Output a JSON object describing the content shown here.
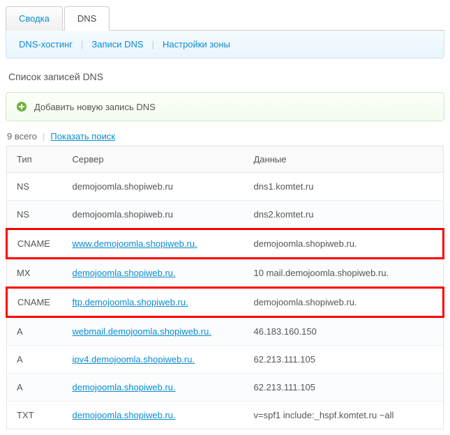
{
  "tabs": {
    "summary": "Сводка",
    "dns": "DNS"
  },
  "subnav": {
    "hosting": "DNS-хостинг",
    "records": "Записи DNS",
    "zone_settings": "Настройки зоны"
  },
  "heading": "Список записей DNS",
  "add_button": "Добавить новую запись DNS",
  "total_count": "9 всего",
  "show_search": "Показать поиск",
  "columns": {
    "type": "Тип",
    "server": "Сервер",
    "data": "Данные"
  },
  "rows": [
    {
      "type": "NS",
      "server": "demojoomla.shopiweb.ru",
      "server_link": false,
      "data": "dns1.komtet.ru",
      "highlight": false
    },
    {
      "type": "NS",
      "server": "demojoomla.shopiweb.ru",
      "server_link": false,
      "data": "dns2.komtet.ru",
      "highlight": false
    },
    {
      "type": "CNAME",
      "server": "www.demojoomla.shopiweb.ru.",
      "server_link": true,
      "data": "demojoomla.shopiweb.ru.",
      "highlight": true
    },
    {
      "type": "MX",
      "server": "demojoomla.shopiweb.ru.",
      "server_link": true,
      "data": "10 mail.demojoomla.shopiweb.ru.",
      "highlight": false
    },
    {
      "type": "CNAME",
      "server": "ftp.demojoomla.shopiweb.ru.",
      "server_link": true,
      "data": "demojoomla.shopiweb.ru.",
      "highlight": true
    },
    {
      "type": "A",
      "server": "webmail.demojoomla.shopiweb.ru.",
      "server_link": true,
      "data": "46.183.160.150",
      "highlight": false
    },
    {
      "type": "A",
      "server": "ipv4.demojoomla.shopiweb.ru.",
      "server_link": true,
      "data": "62.213.111.105",
      "highlight": false
    },
    {
      "type": "A",
      "server": "demojoomla.shopiweb.ru.",
      "server_link": true,
      "data": "62.213.111.105",
      "highlight": false
    },
    {
      "type": "TXT",
      "server": "demojoomla.shopiweb.ru.",
      "server_link": true,
      "data": "v=spf1 include:_hspf.komtet.ru ~all",
      "highlight": false
    }
  ]
}
